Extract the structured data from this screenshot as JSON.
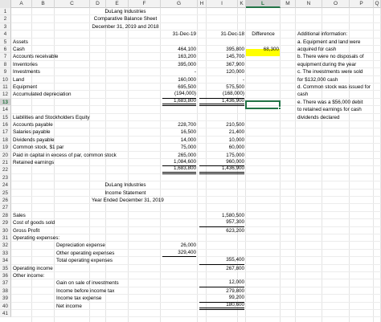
{
  "columns": [
    "A",
    "B",
    "C",
    "D",
    "E",
    "F",
    "G",
    "H",
    "I",
    "K",
    "L",
    "M",
    "N",
    "O",
    "P",
    "Q"
  ],
  "selected_column": "L",
  "selected_row": "13",
  "company": "DuLang Industries",
  "balance_sheet": {
    "title": "Comparative Balance Sheet",
    "period": "December 31, 2019 and 2018",
    "col_2019": "31-Dec-19",
    "col_2018": "31-Dec-18",
    "col_diff": "Difference",
    "assets_label": "Assets",
    "assets": [
      {
        "label": "Cash",
        "v2019": "464,100",
        "v2018": "395,800",
        "diff": "68,300"
      },
      {
        "label": "Accounts receivable",
        "v2019": "163,200",
        "v2018": "145,700",
        "diff": ""
      },
      {
        "label": "Inventories",
        "v2019": "395,000",
        "v2018": "367,900",
        "diff": ""
      },
      {
        "label": "Investments",
        "v2019": "-",
        "v2018": "120,000",
        "diff": ""
      },
      {
        "label": "Land",
        "v2019": "160,000",
        "v2018": "-",
        "diff": ""
      },
      {
        "label": "Equipment",
        "v2019": "695,500",
        "v2018": "575,500",
        "diff": ""
      },
      {
        "label": "Accumulated depreciation",
        "v2019": "(194,000)",
        "v2018": "(168,000)",
        "diff": ""
      }
    ],
    "assets_total": {
      "v2019": "1,683,800",
      "v2018": "1,436,900"
    },
    "liab_label": "Liabilities and Stockholders Equity",
    "liabilities": [
      {
        "label": "Accounts payable",
        "v2019": "228,700",
        "v2018": "210,500"
      },
      {
        "label": "Salaries payable",
        "v2019": "16,500",
        "v2018": "21,400"
      },
      {
        "label": "Dividends payable",
        "v2019": "14,000",
        "v2018": "10,000"
      },
      {
        "label": "Common stock, $1 par",
        "v2019": "75,000",
        "v2018": "60,000"
      },
      {
        "label": "Paid in capital in excess of par, common stock",
        "v2019": "265,000",
        "v2018": "175,000"
      },
      {
        "label": "Retained earnings",
        "v2019": "1,084,600",
        "v2018": "960,000"
      }
    ],
    "liab_total": {
      "v2019": "1,683,800",
      "v2018": "1,436,900"
    }
  },
  "additional_info": {
    "header": "Additional information:",
    "lines": [
      "a. Equipment and land were",
      "acquired for cash",
      "b. There were no disposals of",
      "equipment during the year",
      "c. The investments were sold",
      "for $132,000 cash",
      "d. Common stock was issued for",
      "cash",
      "e. There was a $56,000 debit",
      "to retained earnings for cash",
      "dividends declared"
    ]
  },
  "income_statement": {
    "company": "DuLang Industries",
    "title": "Income Statement",
    "period": "Year Ended December 31, 2019",
    "sales": {
      "label": "Sales",
      "value": "1,580,500"
    },
    "cogs": {
      "label": "Cost of goods sold",
      "value": "957,300"
    },
    "gross": {
      "label": "Gross Profit",
      "value": "623,200"
    },
    "opex_label": "Operating expenses:",
    "depr": {
      "label": "Depreciation expense",
      "value": "26,000"
    },
    "other_opex": {
      "label": "Other operating expenses",
      "value": "329,400"
    },
    "total_opex": {
      "label": "Total operating expenses",
      "value": "355,400"
    },
    "op_income": {
      "label": "Operating income",
      "value": "267,800"
    },
    "other_income_label": "Other income:",
    "gain": {
      "label": "Gain on sale of investments",
      "value": "12,000"
    },
    "ibt": {
      "label": "Income before income tax",
      "value": "279,800"
    },
    "tax": {
      "label": "Income tax expense",
      "value": "99,200"
    },
    "net": {
      "label": "Net income",
      "value": "180,600"
    }
  }
}
